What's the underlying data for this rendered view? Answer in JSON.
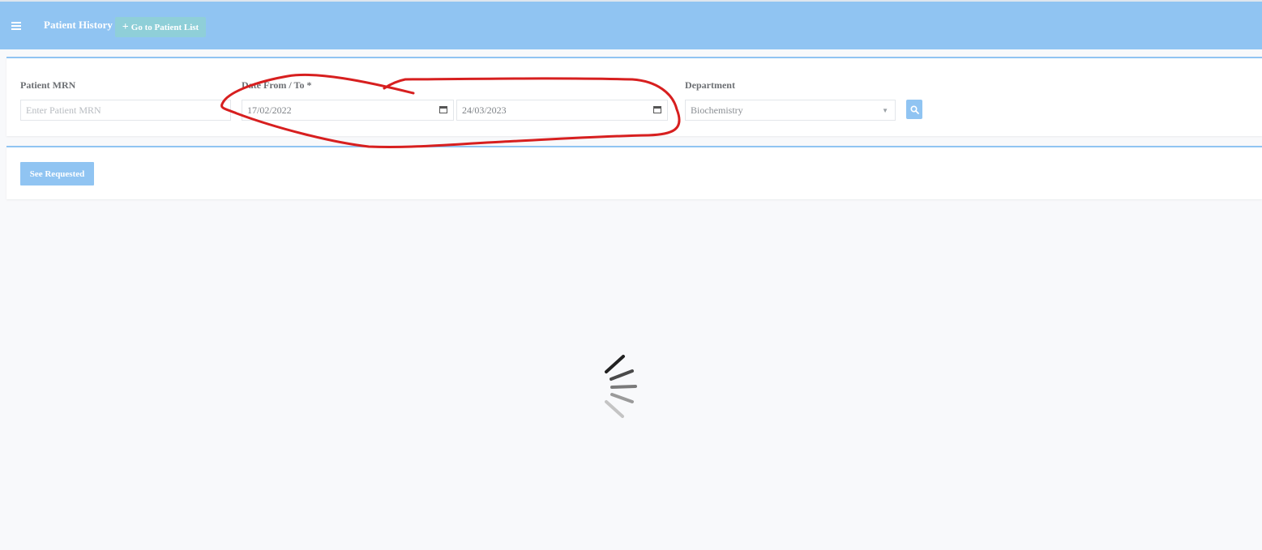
{
  "header": {
    "title": "Patient History",
    "go_to_list_label": "Go to Patient List",
    "accent_color": "#90c4f2"
  },
  "filters": {
    "mrn": {
      "label": "Patient MRN",
      "placeholder": "Enter Patient MRN",
      "value": ""
    },
    "date": {
      "label": "Date From / To *",
      "from": "17/02/2022",
      "to": "24/03/2023"
    },
    "department": {
      "label": "Department",
      "value": "Biochemistry"
    }
  },
  "actions": {
    "see_requested_label": "See Requested"
  },
  "loading": {
    "visible": true
  }
}
